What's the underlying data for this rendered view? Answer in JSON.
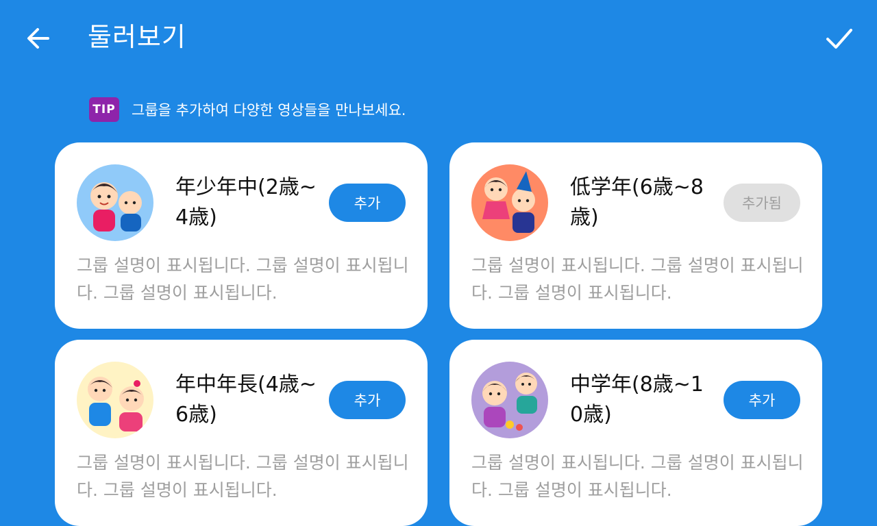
{
  "header": {
    "title": "둘러보기",
    "back_icon": "arrow-left-icon",
    "done_icon": "check-icon"
  },
  "tip": {
    "badge": "TIP",
    "text": "그룹을 추가하여 다양한 영상들을 만나보세요."
  },
  "groups": [
    {
      "title": "年少年中(2歳~4歳)",
      "button": "추가",
      "added": false,
      "description": "그룹 설명이 표시됩니다. 그룹 설명이 표시됩니다. 그룹 설명이 표시됩니다.",
      "avatar_bg": "#90caf9"
    },
    {
      "title": "低学年(6歳~8歳)",
      "button": "추가됨",
      "added": true,
      "description": "그룹 설명이 표시됩니다. 그룹 설명이 표시됩니다. 그룹 설명이 표시됩니다.",
      "avatar_bg": "#ff8a65"
    },
    {
      "title": "年中年長(4歳~6歳)",
      "button": "추가",
      "added": false,
      "description": "그룹 설명이 표시됩니다. 그룹 설명이 표시됩니다. 그룹 설명이 표시됩니다.",
      "avatar_bg": "#fff3c4"
    },
    {
      "title": "中学年(8歳~10歳)",
      "button": "추가",
      "added": false,
      "description": "그룹 설명이 표시됩니다. 그룹 설명이 표시됩니다. 그룹 설명이 표시됩니다.",
      "avatar_bg": "#b39ddb"
    }
  ],
  "colors": {
    "background": "#1e88e5",
    "primary_button": "#1e88e5",
    "added_button": "#e0e0e0",
    "tip_badge": "#8e24aa"
  }
}
